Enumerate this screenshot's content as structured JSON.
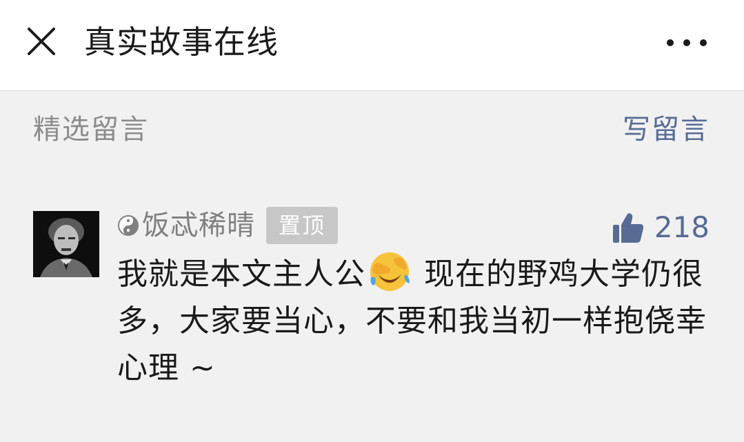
{
  "header": {
    "title": "真实故事在线"
  },
  "comments_section": {
    "heading": "精选留言",
    "write_label": "写留言"
  },
  "comment": {
    "nickname": "饭忒稀晴",
    "nickname_prefix_icon": "yin-yang-icon",
    "pin_label": "置顶",
    "likes": "218",
    "text_before_emoji": "我就是本文主人公",
    "emoji": "facepalm-crying-emoji",
    "text_after_emoji": " 现在的野鸡大学仍很多，大家要当心，不要和我当初一样抱侥幸心理 ~"
  },
  "colors": {
    "link": "#576b95",
    "secondary_text": "#8c8c8c",
    "badge_bg": "#c7c7c7"
  }
}
